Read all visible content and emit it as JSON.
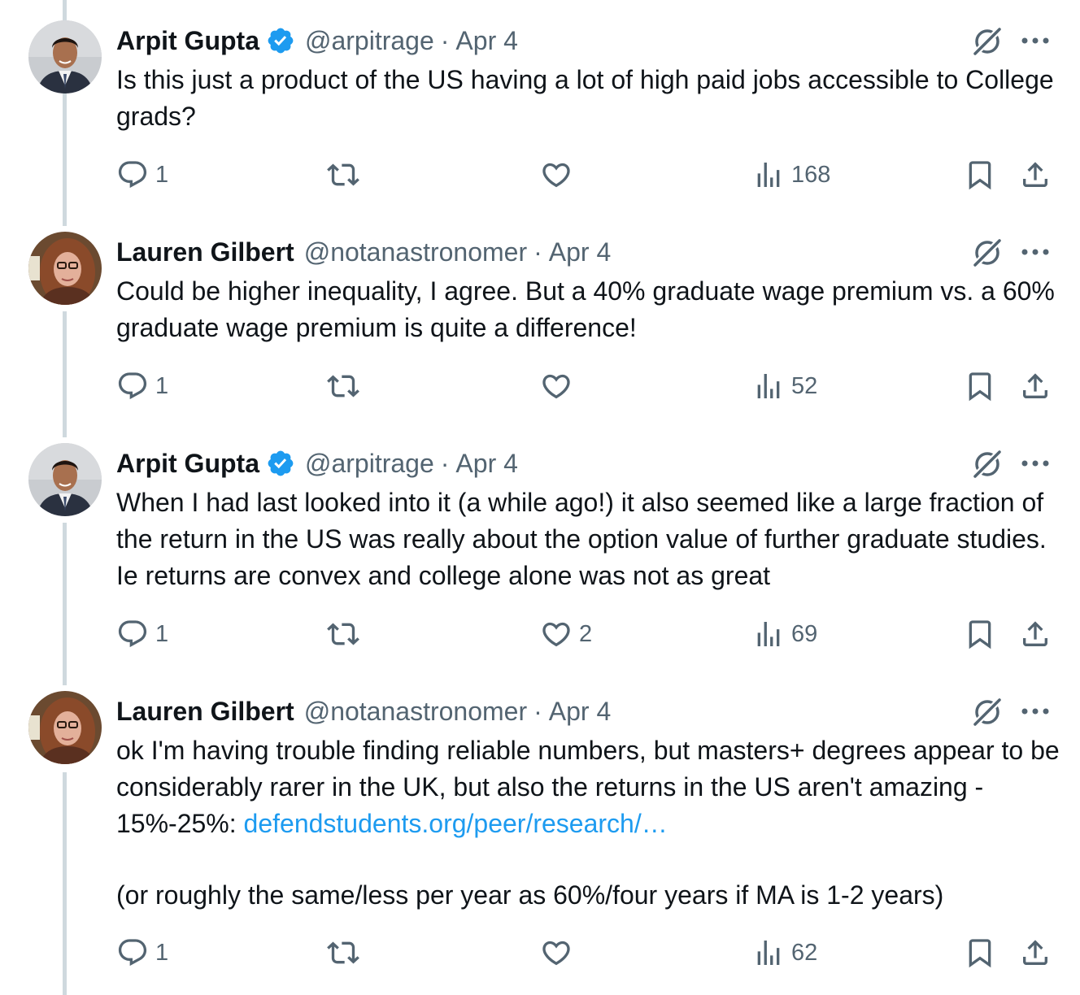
{
  "tweets": [
    {
      "name": "Arpit Gupta",
      "verified": true,
      "handle": "@arpitrage",
      "date": "Apr 4",
      "text": [
        "Is this just a product of the US having a lot of high paid jobs accessible to College grads?"
      ],
      "replies": "1",
      "retweets": "",
      "likes": "",
      "views": "168"
    },
    {
      "name": "Lauren Gilbert",
      "verified": false,
      "handle": "@notanastronomer",
      "date": "Apr 4",
      "text": [
        "Could be higher inequality, I agree. But a 40% graduate wage premium vs. a 60% graduate wage premium is quite a difference!"
      ],
      "replies": "1",
      "retweets": "",
      "likes": "",
      "views": "52"
    },
    {
      "name": "Arpit Gupta",
      "verified": true,
      "handle": "@arpitrage",
      "date": "Apr 4",
      "text": [
        "When I had last looked into it (a while ago!) it also seemed like a large fraction of the return in the US was really about the option value of further graduate studies. Ie returns are convex and college alone was not as great"
      ],
      "replies": "1",
      "retweets": "",
      "likes": "2",
      "views": "69"
    },
    {
      "name": "Lauren Gilbert",
      "verified": false,
      "handle": "@notanastronomer",
      "date": "Apr 4",
      "text_before_link": "ok I'm having trouble finding reliable numbers, but masters+ degrees appear to be considerably rarer in the UK, but also the returns in the US aren't amazing - 15%-25%: ",
      "link": "defendstudents.org/peer/research/…",
      "text_after": "(or roughly the same/less per year as 60%/four years if MA is 1-2 years)",
      "replies": "1",
      "retweets": "",
      "likes": "",
      "views": "62"
    }
  ],
  "colors": {
    "text": "#0f1419",
    "secondary": "#536471",
    "link": "#1d9bf0",
    "verified": "#1d9bf0",
    "thread_line": "#cfd9de"
  },
  "icons": [
    "verified-badge-icon",
    "grok-icon",
    "more-icon",
    "reply-icon",
    "retweet-icon",
    "like-icon",
    "views-icon",
    "bookmark-icon",
    "share-icon"
  ]
}
